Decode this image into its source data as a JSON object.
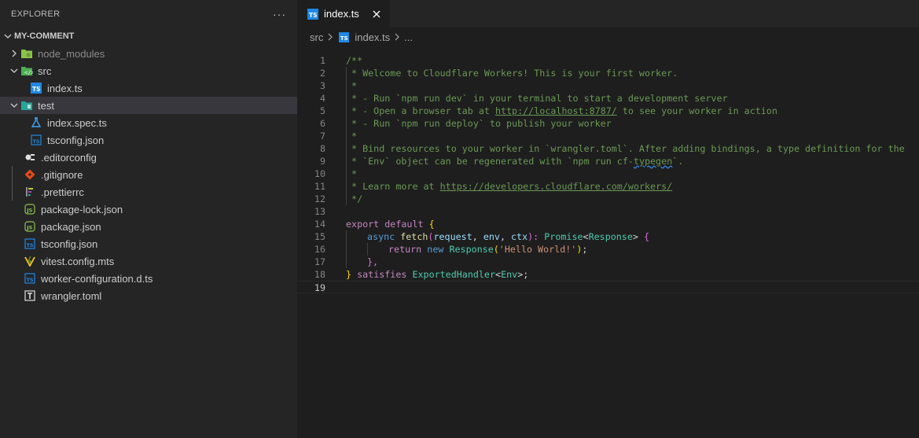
{
  "sidebar": {
    "title": "EXPLORER",
    "more_label": "···",
    "root": "MY-COMMENT",
    "items": [
      {
        "label": "node_modules",
        "icon": "folder-node-icon"
      },
      {
        "label": "src",
        "icon": "folder-src-icon"
      },
      {
        "label": "index.ts",
        "icon": "typescript-file-icon"
      },
      {
        "label": "test",
        "icon": "folder-test-icon"
      },
      {
        "label": "index.spec.ts",
        "icon": "test-flask-icon"
      },
      {
        "label": "tsconfig.json",
        "icon": "tsconfig-icon"
      },
      {
        "label": ".editorconfig",
        "icon": "editorconfig-icon"
      },
      {
        "label": ".gitignore",
        "icon": "git-icon"
      },
      {
        "label": ".prettierrc",
        "icon": "prettier-icon"
      },
      {
        "label": "package-lock.json",
        "icon": "js-package-icon"
      },
      {
        "label": "package.json",
        "icon": "js-package-icon"
      },
      {
        "label": "tsconfig.json",
        "icon": "tsconfig-icon"
      },
      {
        "label": "vitest.config.mts",
        "icon": "vitest-icon"
      },
      {
        "label": "worker-configuration.d.ts",
        "icon": "typescript-def-icon"
      },
      {
        "label": "wrangler.toml",
        "icon": "toml-icon"
      }
    ]
  },
  "editor": {
    "tab": {
      "label": "index.ts"
    },
    "breadcrumb": {
      "folder": "src",
      "file": "index.ts",
      "more": "..."
    },
    "line_numbers": [
      "1",
      "2",
      "3",
      "4",
      "5",
      "6",
      "7",
      "8",
      "9",
      "10",
      "11",
      "12",
      "13",
      "14",
      "15",
      "16",
      "17",
      "18",
      "19"
    ],
    "comment": {
      "l1": "/**",
      "l2": " * Welcome to Cloudflare Workers! This is your first worker.",
      "l3": " *",
      "l4": " * - Run `npm run dev` in your terminal to start a development server",
      "l5a": " * - Open a browser tab at ",
      "l5link": "http://localhost:8787/",
      "l5b": " to see your worker in action",
      "l6": " * - Run `npm run deploy` to publish your worker",
      "l7": " *",
      "l8": " * Bind resources to your worker in `wrangler.toml`. After adding bindings, a type definition for the",
      "l9a": " * `Env` object can be regenerated with `npm run cf-",
      "l9sq": "typegen",
      "l9b": "`.",
      "l10": " *",
      "l11a": " * Learn more at ",
      "l11link": "https://developers.cloudflare.com/workers/",
      "l12": " */"
    },
    "code": {
      "export": "export",
      "default": " default ",
      "obrace": "{",
      "async": "async",
      "fetch": "fetch",
      "paren_open": "(",
      "request": "request",
      "comma1": ", ",
      "env": "env",
      "comma2": ", ",
      "ctx": "ctx",
      "paren_close": "):",
      "promise": "Promise",
      "lt": "<",
      "response_type": "Response",
      "gt": ">",
      "brace2": "{",
      "return": "return",
      "new": "new",
      "response_ctor": "Response",
      "p_open": "(",
      "string": "'Hello World!'",
      "p_close": ")",
      "semi": ";",
      "close_inner": "},",
      "cbrace": "}",
      "satisfies": " satisfies ",
      "handler": "ExportedHandler",
      "lt2": "<",
      "env_type": "Env",
      "gt2": ">",
      "semi2": ";"
    }
  }
}
